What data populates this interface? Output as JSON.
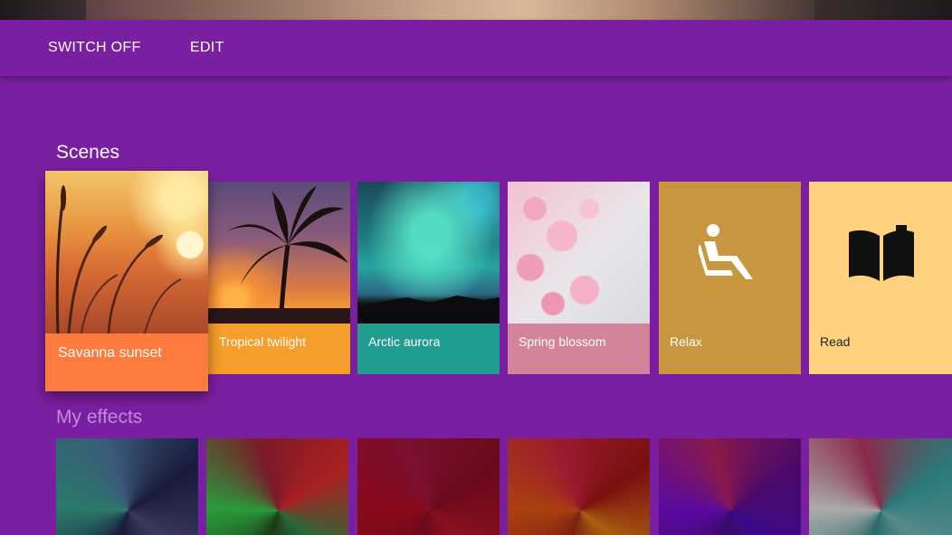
{
  "toolbar": {
    "switch_off_label": "SWITCH OFF",
    "edit_label": "EDIT"
  },
  "scenes": {
    "title": "Scenes",
    "items": [
      {
        "label": "Savanna sunset",
        "color": "#ff7a3d",
        "selected": true
      },
      {
        "label": "Tropical twilight",
        "color": "#f59e2b"
      },
      {
        "label": "Arctic aurora",
        "color": "#1f9e8f"
      },
      {
        "label": "Spring blossom",
        "color": "#d4849a"
      },
      {
        "label": "Relax",
        "color": "#c8963e",
        "icon": "relax-recliner-icon"
      },
      {
        "label": "Read",
        "color": "#ffd27f",
        "icon": "open-book-icon"
      }
    ]
  },
  "effects": {
    "title": "My effects",
    "count_visible": 6
  },
  "colors": {
    "background": "#7b1fa2",
    "effects_title": "#c389de"
  }
}
